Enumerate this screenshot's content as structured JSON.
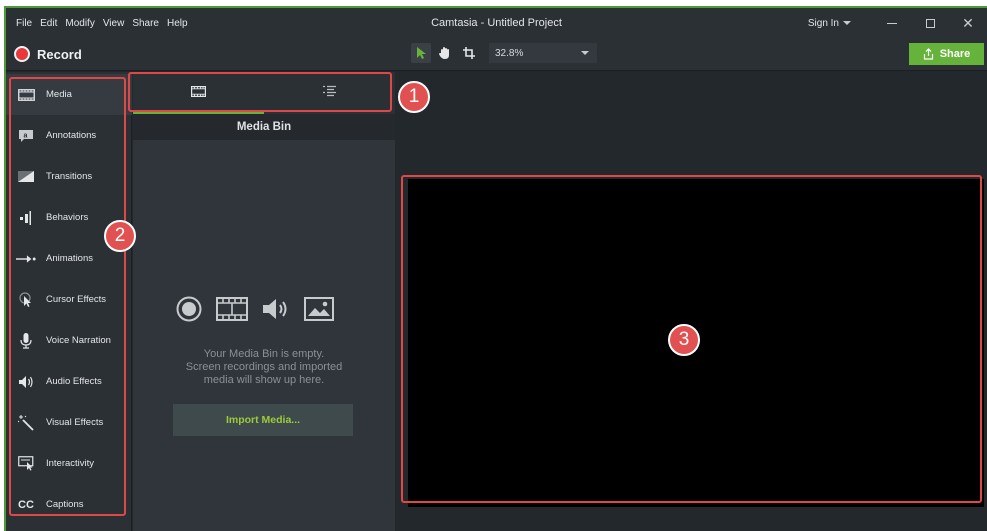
{
  "menubar": {
    "items": [
      "File",
      "Edit",
      "Modify",
      "View",
      "Share",
      "Help"
    ],
    "title": "Camtasia - Untitled Project",
    "signin": "Sign In"
  },
  "toolbar": {
    "record_label": "Record",
    "zoom_value": "32.8%",
    "share_label": "Share"
  },
  "sidebar": {
    "items": [
      {
        "label": "Media",
        "icon": "film-icon"
      },
      {
        "label": "Annotations",
        "icon": "annotation-icon"
      },
      {
        "label": "Transitions",
        "icon": "transition-icon"
      },
      {
        "label": "Behaviors",
        "icon": "behaviors-icon"
      },
      {
        "label": "Animations",
        "icon": "animation-arrow-icon"
      },
      {
        "label": "Cursor Effects",
        "icon": "cursor-effects-icon"
      },
      {
        "label": "Voice Narration",
        "icon": "microphone-icon"
      },
      {
        "label": "Audio Effects",
        "icon": "speaker-icon"
      },
      {
        "label": "Visual Effects",
        "icon": "magic-wand-icon"
      },
      {
        "label": "Interactivity",
        "icon": "interactivity-icon"
      },
      {
        "label": "Captions",
        "icon": "cc-icon"
      }
    ]
  },
  "bin": {
    "title": "Media Bin",
    "empty_line1": "Your Media Bin is empty.",
    "empty_line2": "Screen recordings and imported",
    "empty_line3": "media will show up here.",
    "import_label": "Import Media..."
  },
  "annotations": {
    "badge1": "1",
    "badge2": "2",
    "badge3": "3",
    "color": "#e04848"
  },
  "colors": {
    "accent_green": "#66b33b",
    "record_red": "#e8383b",
    "canvas": "#000000"
  }
}
